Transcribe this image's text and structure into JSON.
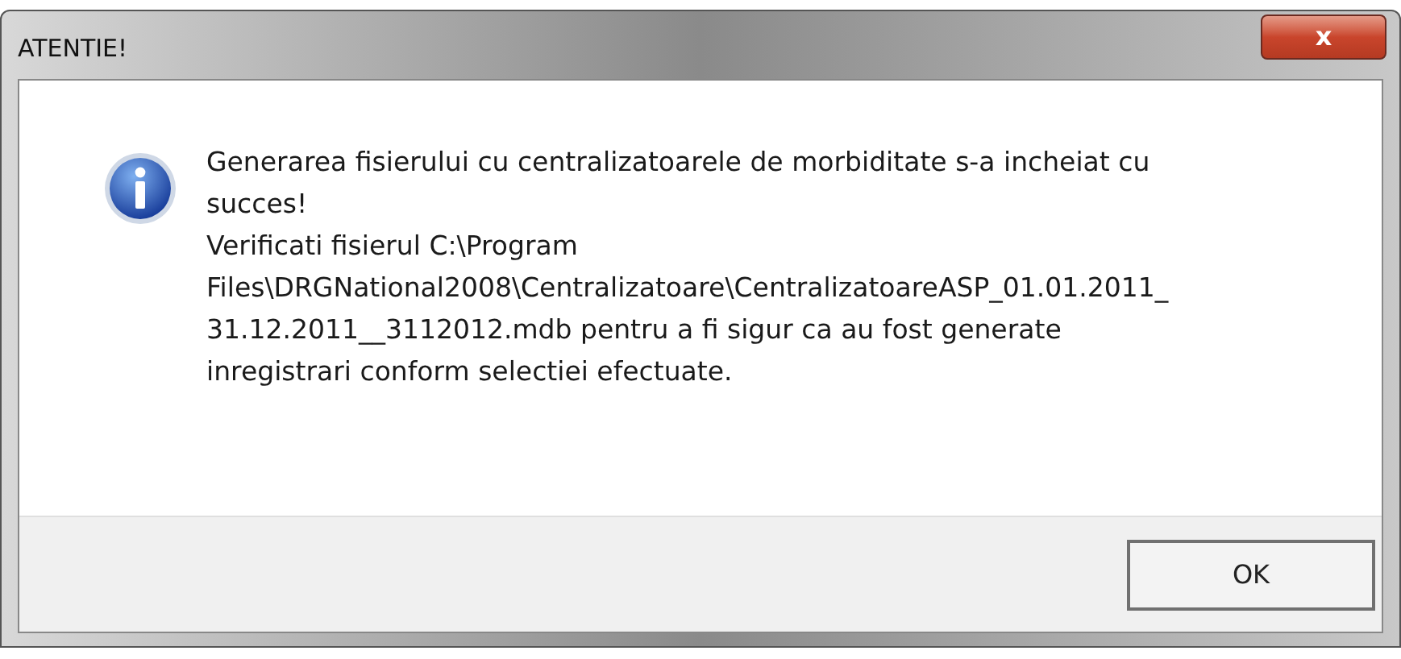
{
  "window": {
    "title": "ATENTIE!",
    "close_button": "x"
  },
  "message": {
    "kind": "info",
    "lines": [
      "Generarea fisierului cu centralizatoarele de morbiditate s-a incheiat cu",
      "succes!",
      "Verificati fisierul C:\\Program",
      "Files\\DRGNational2008\\Centralizatoare\\CentralizatoareASP_01.01.2011_",
      "31.12.2011__3112012.mdb pentru a fi sigur ca au fost generate",
      "inregistrari conform selectiei efectuate."
    ]
  },
  "buttons": [
    "OK"
  ]
}
